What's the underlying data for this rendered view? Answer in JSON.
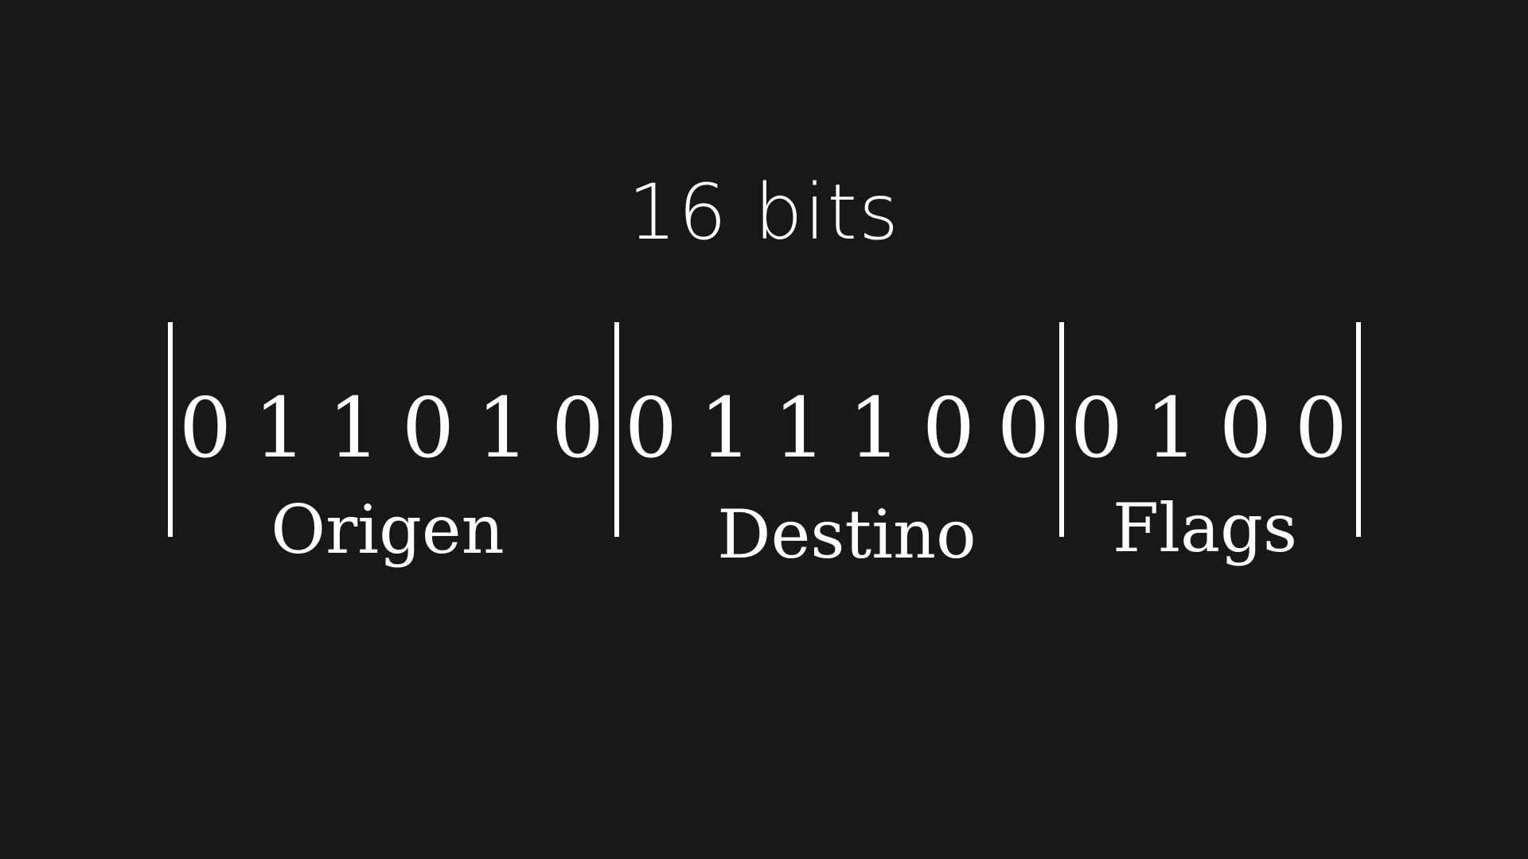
{
  "title": "16 bits",
  "fields": [
    {
      "label": "Origen",
      "bits": [
        "0",
        "1",
        "1",
        "0",
        "1",
        "0"
      ]
    },
    {
      "label": "Destino",
      "bits": [
        "0",
        "1",
        "1",
        "1",
        "0",
        "0"
      ]
    },
    {
      "label": "Flags",
      "bits": [
        "0",
        "1",
        "0",
        "0"
      ]
    }
  ],
  "colors": {
    "background": "#17181a",
    "foreground": "#ffffff"
  }
}
